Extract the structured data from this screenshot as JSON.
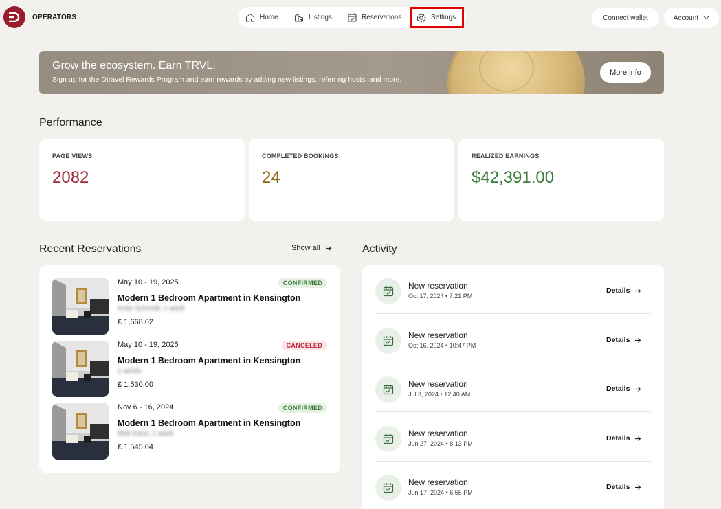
{
  "header": {
    "brand": "OPERATORS",
    "nav": [
      {
        "label": "Home",
        "icon": "home-icon"
      },
      {
        "label": "Listings",
        "icon": "listings-icon"
      },
      {
        "label": "Reservations",
        "icon": "calendar-icon"
      },
      {
        "label": "Settings",
        "icon": "gear-icon",
        "highlighted": true
      }
    ],
    "connect_wallet": "Connect wallet",
    "account": "Account"
  },
  "banner": {
    "title": "Grow the ecosystem. Earn TRVL.",
    "subtitle": "Sign up for the Dtravel Rewards Program and earn rewards by adding new listings, referring hosts, and more.",
    "button": "More info"
  },
  "performance": {
    "title": "Performance",
    "stats": [
      {
        "label": "PAGE VIEWS",
        "value": "2082",
        "color": "#9b2c3a"
      },
      {
        "label": "COMPLETED BOOKINGS",
        "value": "24",
        "color": "#8c6a14"
      },
      {
        "label": "REALIZED EARNINGS",
        "value": "$42,391.00",
        "color": "#3a7a3a"
      }
    ]
  },
  "reservations": {
    "title": "Recent Reservations",
    "show_all": "Show all",
    "items": [
      {
        "dates": "May 10 - 19, 2025",
        "status": "CONFIRMED",
        "name": "Modern 1 Bedroom Apartment in Kensington",
        "guest": "Anke Schmidt, 1 adult",
        "price": "£ 1,668.62"
      },
      {
        "dates": "May 10 - 19, 2025",
        "status": "CANCELED",
        "name": "Modern 1 Bedroom Apartment in Kensington",
        "guest": "2 adults",
        "price": "£ 1,530.00"
      },
      {
        "dates": "Nov 6 - 16, 2024",
        "status": "CONFIRMED",
        "name": "Modern 1 Bedroom Apartment in Kensington",
        "guest": "Bilal Kane, 1 adult",
        "price": "£ 1,545.04"
      }
    ]
  },
  "activity": {
    "title": "Activity",
    "details_label": "Details",
    "items": [
      {
        "title": "New reservation",
        "time": "Oct 17, 2024 • 7:21 PM"
      },
      {
        "title": "New reservation",
        "time": "Oct 16, 2024 • 10:47 PM"
      },
      {
        "title": "New reservation",
        "time": "Jul 3, 2024 • 12:40 AM"
      },
      {
        "title": "New reservation",
        "time": "Jun 27, 2024 • 8:13 PM"
      },
      {
        "title": "New reservation",
        "time": "Jun 17, 2024 • 6:55 PM"
      }
    ]
  }
}
